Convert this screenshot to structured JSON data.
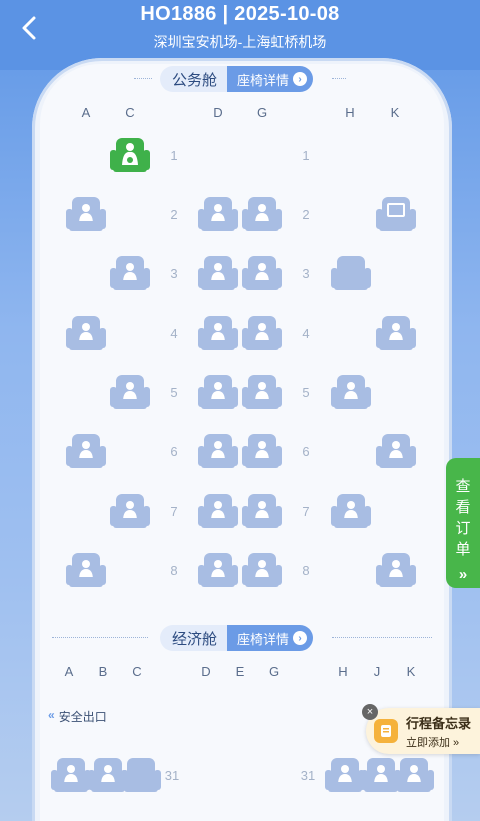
{
  "header": {
    "title": "HO1886 | 2025-10-08",
    "route": "深圳宝安机场-上海虹桥机场"
  },
  "business": {
    "name": "公务舱",
    "detail_label": "座椅详情",
    "columns": [
      "A",
      "C",
      "D",
      "G",
      "H",
      "K"
    ],
    "rows": [
      "1",
      "2",
      "3",
      "4",
      "5",
      "6",
      "7",
      "8"
    ]
  },
  "economy": {
    "name": "经济舱",
    "detail_label": "座椅详情",
    "columns": [
      "A",
      "B",
      "C",
      "D",
      "E",
      "G",
      "H",
      "J",
      "K"
    ],
    "rows": [
      "31"
    ]
  },
  "side_tab": {
    "label": [
      "查",
      "看",
      "订",
      "单"
    ]
  },
  "exit": {
    "label": "安全出口"
  },
  "memo": {
    "title": "行程备忘录",
    "subtitle": "立即添加 »"
  },
  "colors": {
    "header": "#5b93e4",
    "seat": "#a8bde3",
    "seat_selected": "#3fb14a",
    "side_tab": "#48b64a"
  }
}
